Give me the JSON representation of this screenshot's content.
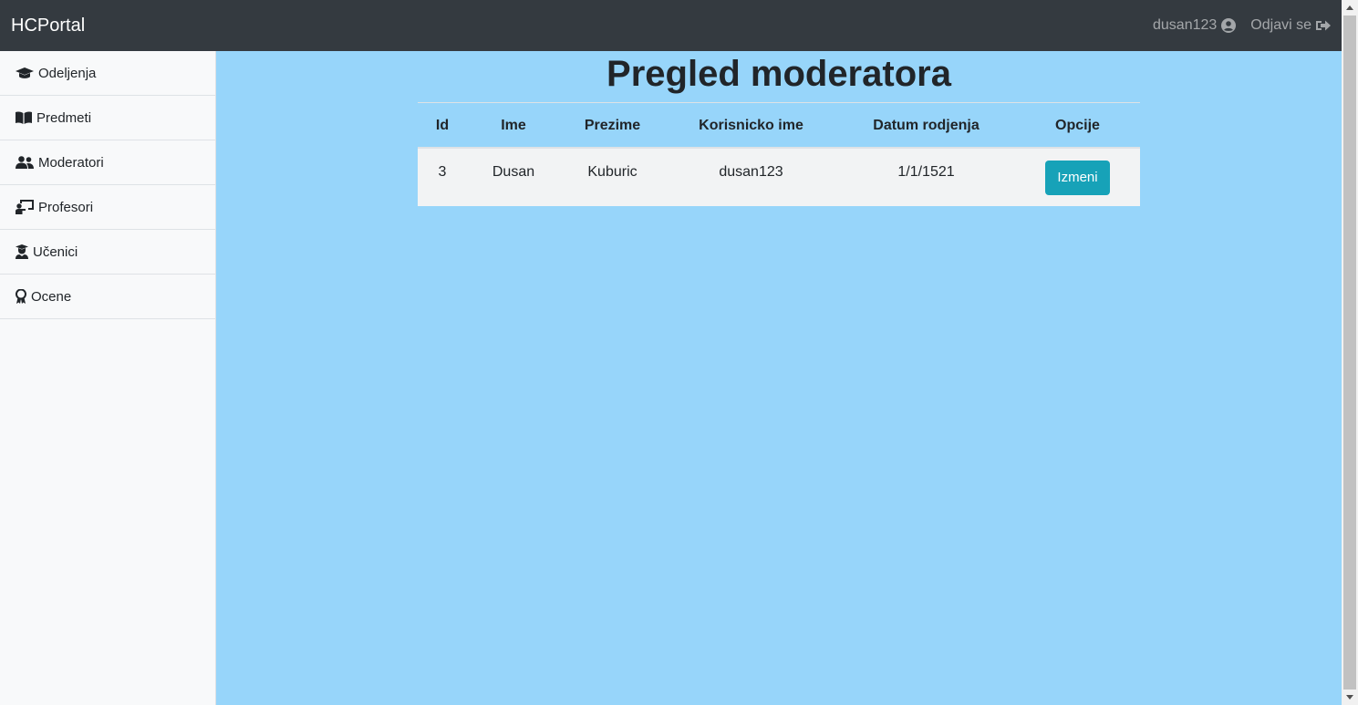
{
  "app": {
    "brand": "HCPortal"
  },
  "navbar": {
    "username": "dusan123",
    "logout_label": "Odjavi se"
  },
  "sidebar": {
    "items": [
      {
        "label": "Odeljenja",
        "icon": "graduation-cap-icon"
      },
      {
        "label": "Predmeti",
        "icon": "book-open-icon"
      },
      {
        "label": "Moderatori",
        "icon": "users-icon"
      },
      {
        "label": "Profesori",
        "icon": "chalkboard-teacher-icon"
      },
      {
        "label": "Učenici",
        "icon": "user-graduate-icon"
      },
      {
        "label": "Ocene",
        "icon": "award-icon"
      }
    ]
  },
  "main": {
    "title": "Pregled moderatora",
    "table": {
      "headers": [
        "Id",
        "Ime",
        "Prezime",
        "Korisnicko ime",
        "Datum rodjenja",
        "Opcije"
      ],
      "rows": [
        {
          "id": "3",
          "ime": "Dusan",
          "prezime": "Kuburic",
          "korisnicko_ime": "dusan123",
          "datum_rodjenja": "1/1/1521",
          "action_label": "Izmeni"
        }
      ]
    }
  },
  "colors": {
    "navbar": "#343a40",
    "main_bg": "#97d5fa",
    "button": "#17a2b8"
  }
}
